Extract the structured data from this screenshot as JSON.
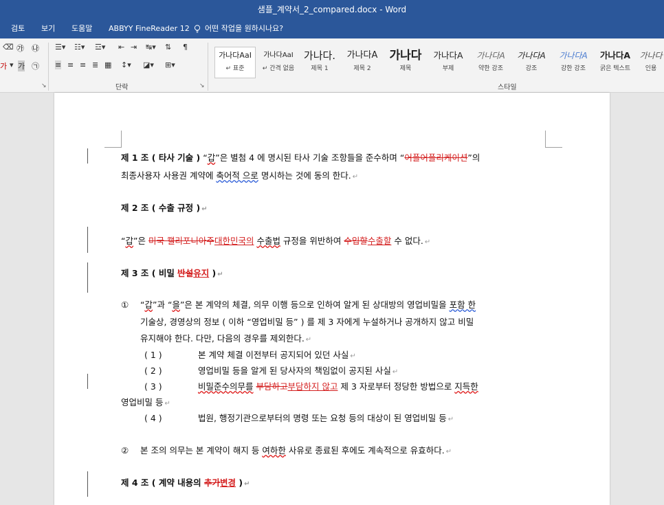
{
  "window": {
    "title": "샘플_계약서_2_compared.docx  -  Word"
  },
  "ribbon_tabs": [
    "검토",
    "보기",
    "도움말",
    "ABBYY FineReader 12"
  ],
  "tell_me": "어떤 작업을 원하시나요?",
  "groups": {
    "paragraph": "단락",
    "styles": "스타일"
  },
  "font_group_icons": {
    "a": "가",
    "b": "가"
  },
  "styles": [
    {
      "sample": "가나다AaI",
      "name": "↵ 표준"
    },
    {
      "sample": "가나다AaI",
      "name": "↵ 간격 없음"
    },
    {
      "sample": "가나다.",
      "name": "제목 1"
    },
    {
      "sample": "가나다A",
      "name": "제목 2"
    },
    {
      "sample": "가나다",
      "name": "제목"
    },
    {
      "sample": "가나다A",
      "name": "부제"
    },
    {
      "sample": "가나다A",
      "name": "약한 강조"
    },
    {
      "sample": "가나다A",
      "name": "강조"
    },
    {
      "sample": "가나다A",
      "name": "강한 강조"
    },
    {
      "sample": "가나다A",
      "name": "굵은 텍스트"
    },
    {
      "sample": "가나다",
      "name": "인용"
    }
  ],
  "doc": {
    "a1_head": "제 1 조 ( 타사 기술 )",
    "a1_t1": " “",
    "a1_gap": "갑",
    "a1_t2": "”은 별첨 4 에 명시된 타사 기술 조항들을 준수하며 “",
    "a1_del": "어플어플리케이션",
    "a1_t3": "”의",
    "a1_l2a": "최종사용자 사용권 계약에 ",
    "a1_l2sq": "축어적 으로",
    "a1_l2b": " 명시하는 것에 동의 한다.",
    "a2_head": "제 2  조 ( 수출 규정 )",
    "a2_t1": "“",
    "a2_gap": "갑",
    "a2_t2": "”은 ",
    "a2_del": "미국 캘리포니아주",
    "a2_ins": "대한민국의",
    "a2_t3": " ",
    "a2_sq": "수출법",
    "a2_t4": " 규정을 위반하여 ",
    "a2_del2": "수입할",
    "a2_ins2": "수출할",
    "a2_t5": " 수 없다.",
    "a3_head": "제 3  조 ( 비밀 ",
    "a3_del": "반설",
    "a3_ins": "유지",
    "a3_close": " )",
    "a3_p1_num": "①",
    "a3_p1_a": "“",
    "a3_p1_gap": "갑",
    "a3_p1_b": "”과 “",
    "a3_p1_eul": "을",
    "a3_p1_c": "”은 본 계약의 체결, 의무 이행 등으로 인하여 알게 된 상대방의 영업비밀을 ",
    "a3_p1_sq": "포함 한",
    "a3_p1_l2": "기술상, 경영상의 정보 ( 이하 “영업비밀 등” ) 를 제 3 자에게 누설하거나 공개하지 않고 비밀",
    "a3_p1_l3": "유지해야 한다. 다만, 다음의 경우를 제외한다.",
    "s1_num": "( 1 )",
    "s1_text": "본 계약 체결 이전부터 공지되어 있던 사실",
    "s2_num": "( 2 )",
    "s2_text": "영업비밀 등을 알게 된 당사자의 책임없이 공지된 사실",
    "s3_num": "( 3 )",
    "s3_sq": "비밀준수의무를",
    "s3_t1": " ",
    "s3_del": "부담하고",
    "s3_ins": "부담하지 않고",
    "s3_t2": " 제 3 자로부터 정당한 방법으로 ",
    "s3_sq2": "지득한",
    "s3_l2": "영업비밀 등",
    "s4_num": "( 4 )",
    "s4_text": "법원, 행정기관으로부터의 명령 또는 요청 등의 대상이 된 영업비밀 등",
    "a3_p2_num": "②",
    "a3_p2_a": "본 조의 의무는 본 계약이 해지 등   ",
    "a3_p2_sq": "여하한",
    "a3_p2_b": " 사유로  종료된 후에도  계속적으로 유효하다.",
    "a4_head": "제 4  조 ( 계약 내용의 ",
    "a4_del": "추가",
    "a4_ins": "변경",
    "a4_close": " )",
    "pilcrow": "↵"
  }
}
